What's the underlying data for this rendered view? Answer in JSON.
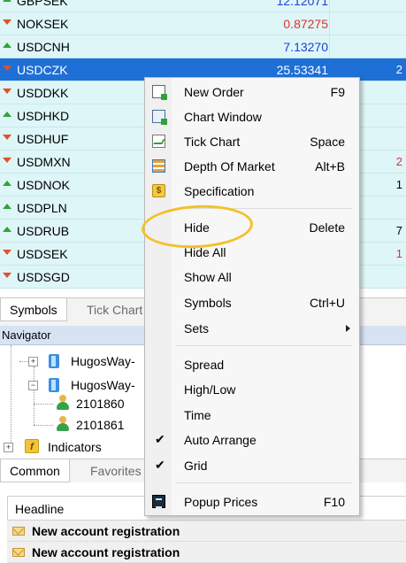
{
  "market_watch": {
    "rows": [
      {
        "symbol": "GBPSEK",
        "price": "12.12071",
        "direction": "up",
        "edge": ""
      },
      {
        "symbol": "NOKSEK",
        "price": "0.87275",
        "direction": "down",
        "edge": ""
      },
      {
        "symbol": "USDCNH",
        "price": "7.13270",
        "direction": "up",
        "edge": ""
      },
      {
        "symbol": "USDCZK",
        "price": "25.53341",
        "direction": "down",
        "edge": "2"
      },
      {
        "symbol": "USDDKK",
        "price": "",
        "direction": "down",
        "edge": ""
      },
      {
        "symbol": "USDHKD",
        "price": "",
        "direction": "up",
        "edge": ""
      },
      {
        "symbol": "USDHUF",
        "price": "",
        "direction": "down",
        "edge": ""
      },
      {
        "symbol": "USDMXN",
        "price": "",
        "direction": "down",
        "edge": "2"
      },
      {
        "symbol": "USDNOK",
        "price": "",
        "direction": "up",
        "edge": "1"
      },
      {
        "symbol": "USDPLN",
        "price": "",
        "direction": "up",
        "edge": ""
      },
      {
        "symbol": "USDRUB",
        "price": "",
        "direction": "up",
        "edge": "7"
      },
      {
        "symbol": "USDSEK",
        "price": "",
        "direction": "down",
        "edge": "1"
      },
      {
        "symbol": "USDSGD",
        "price": "",
        "direction": "down",
        "edge": ""
      }
    ],
    "selected_symbol": "USDCZK",
    "tabs": [
      "Symbols",
      "Tick Chart"
    ]
  },
  "navigator": {
    "title": "Navigator",
    "items": {
      "server1": "HugosWay-",
      "server2": "HugosWay-",
      "account1": "2101860",
      "account2": "2101861",
      "indicators": "Indicators"
    },
    "tabs": [
      "Common",
      "Favorites"
    ]
  },
  "news": {
    "column_header": "Headline",
    "rows": [
      "New account registration",
      "New account registration"
    ]
  },
  "context_menu": {
    "items": [
      {
        "label": "New Order",
        "shortcut": "F9",
        "icon": "new-order-icon"
      },
      {
        "label": "Chart Window",
        "shortcut": "",
        "icon": "chart-window-icon"
      },
      {
        "label": "Tick Chart",
        "shortcut": "Space",
        "icon": "tick-chart-icon"
      },
      {
        "label": "Depth Of Market",
        "shortcut": "Alt+B",
        "icon": "depth-of-market-icon"
      },
      {
        "label": "Specification",
        "shortcut": "",
        "icon": "specification-icon"
      },
      {
        "label": "Hide",
        "shortcut": "Delete"
      },
      {
        "label": "Hide All",
        "shortcut": ""
      },
      {
        "label": "Show All",
        "shortcut": ""
      },
      {
        "label": "Symbols",
        "shortcut": "Ctrl+U"
      },
      {
        "label": "Sets",
        "shortcut": ""
      },
      {
        "label": "Spread",
        "shortcut": ""
      },
      {
        "label": "High/Low",
        "shortcut": ""
      },
      {
        "label": "Time",
        "shortcut": ""
      },
      {
        "label": "Auto Arrange",
        "shortcut": "",
        "checked": true
      },
      {
        "label": "Grid",
        "shortcut": "",
        "checked": true
      },
      {
        "label": "Popup Prices",
        "shortcut": "F10",
        "icon": "popup-prices-icon"
      }
    ]
  },
  "colors": {
    "row_background": "#dff6f8",
    "selected_row": "#1e6fd6",
    "price_up": "#1b3fd6",
    "price_down": "#e03030",
    "highlight_ring": "#f3c12a"
  }
}
